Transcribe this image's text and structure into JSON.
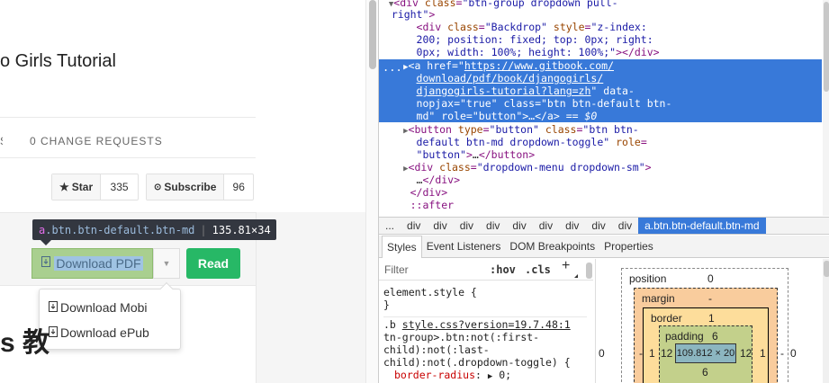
{
  "page": {
    "title_fragment": "o Girls Tutorial",
    "tabs_fragment": "S",
    "change_requests_tab": "0 CHANGE REQUESTS",
    "star": {
      "label": "Star",
      "count": "335"
    },
    "subscribe": {
      "label": "Subscribe",
      "count": "96"
    },
    "download_pdf": "Download PDF",
    "read": "Read",
    "dropdown_items": [
      "Download Mobi",
      "Download ePub"
    ],
    "heading_fragment": "s 教"
  },
  "tooltip": {
    "tag": "a",
    "classes": ".btn.btn-default.btn-md",
    "dimensions": "135.81×34"
  },
  "devtools": {
    "elements": {
      "lines_before": [
        {
          "indent": "  ▼<",
          "tag": "div",
          "rest_attr": " class=",
          "rest_val": "\"btn-group dropdown pull-"
        },
        {
          "text": "  right\">"
        },
        {
          "indent": "      <",
          "tag": "div",
          "rest_attr": " class=",
          "rest_val": "\"Backdrop\"",
          "attr2": " style=",
          "val2": "\"z-index:"
        },
        {
          "text": "      200; position: fixed; top: 0px; right:"
        },
        {
          "text": "      0px; width: 100%; height: 100%;\"></div>"
        }
      ],
      "selected_lines": [
        "     ▶<a href=\"https://www.gitbook.com/",
        "      download/pdf/book/djangogirls/",
        "      djangogirls-tutorial?lang=zh\" data-",
        "      nopjax=\"true\" class=\"btn btn-default btn-",
        "      md\" role=\"button\">…</a> == $0"
      ],
      "selected_ellipsis": "...",
      "lines_after": [
        "     ▶<button type=\"button\" class=\"btn btn-",
        "      default btn-md dropdown-toggle\" role=",
        "      \"button\">…</button>",
        "     ▶<div class=\"dropdown-menu dropdown-sm\">",
        "      …</div>",
        "     </div>",
        "     ::after"
      ]
    },
    "breadcrumbs": [
      "...",
      "div",
      "div",
      "div",
      "div",
      "div",
      "div",
      "div",
      "div",
      "div",
      "a.btn.btn-default.btn-md"
    ],
    "subtabs": [
      "Styles",
      "Event Listeners",
      "DOM Breakpoints",
      "Properties"
    ],
    "styles": {
      "filter_placeholder": "Filter",
      "hov": ":hov",
      "cls": ".cls",
      "plus": "+",
      "element_style": "element.style {",
      "close_brace": "}",
      "rule_selector_prefix": ".b ",
      "rule_source": "style.css?version=19.7.48:1",
      "rule_lines": [
        "tn-group>.btn:not(:first-",
        "child):not(:last-",
        "child):not(.dropdown-toggle) {"
      ],
      "prop_name": "border-radius",
      "prop_value": "0;"
    },
    "box_model": {
      "position_label": "position",
      "position_value": "0",
      "margin_label": "margin",
      "margin_value": "-",
      "border_label": "border",
      "border_value": "1",
      "padding_label": "padding",
      "padding_value": "6",
      "padding_bottom": "6",
      "content": "109.812 × 20",
      "left_position": "0",
      "left_margin": "-",
      "left_border": "1",
      "left_padding": "12",
      "right_padding": "12",
      "right_border": "1",
      "right_margin": "-",
      "right_position": "0"
    }
  }
}
